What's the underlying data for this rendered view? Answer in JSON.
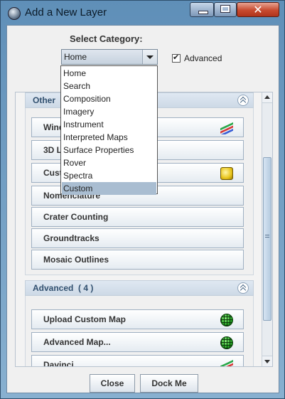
{
  "window": {
    "title": "Add a New Layer",
    "close_glyph": "✕"
  },
  "selector": {
    "label": "Select Category:",
    "selected_value": "Home",
    "options": [
      "Home",
      "Search",
      "Composition",
      "Imagery",
      "Instrument",
      "Interpreted Maps",
      "Surface Properties",
      "Rover",
      "Spectra",
      "Custom"
    ],
    "highlighted_option": "Custom"
  },
  "advanced_checkbox": {
    "label": "Advanced",
    "checked": true,
    "check_glyph": "✔"
  },
  "groups": [
    {
      "title": "Other  (",
      "buttons": [
        {
          "label": "Wind",
          "icon": "layers-icon"
        },
        {
          "label": "3D L",
          "icon": ""
        },
        {
          "label": "Cust",
          "icon": "custom-layer-icon"
        },
        {
          "label": "Nomenclature",
          "icon": ""
        },
        {
          "label": "Crater Counting",
          "icon": ""
        },
        {
          "label": "Groundtracks",
          "icon": ""
        },
        {
          "label": "Mosaic Outlines",
          "icon": ""
        }
      ]
    },
    {
      "title": "Advanced  ( 4 )",
      "buttons": [
        {
          "label": "Upload Custom Map",
          "icon": "globe-icon"
        },
        {
          "label": "Advanced Map...",
          "icon": "globe-icon"
        },
        {
          "label": "Davinci",
          "icon": "layers-icon"
        }
      ]
    }
  ],
  "footer": {
    "close_label": "Close",
    "dock_label": "Dock Me"
  },
  "colors": {
    "title_bar": "#6f9ac0",
    "close_button": "#c74a2f",
    "popup_highlight": "#a9bdd1",
    "group_header": "#dfe8f2"
  }
}
